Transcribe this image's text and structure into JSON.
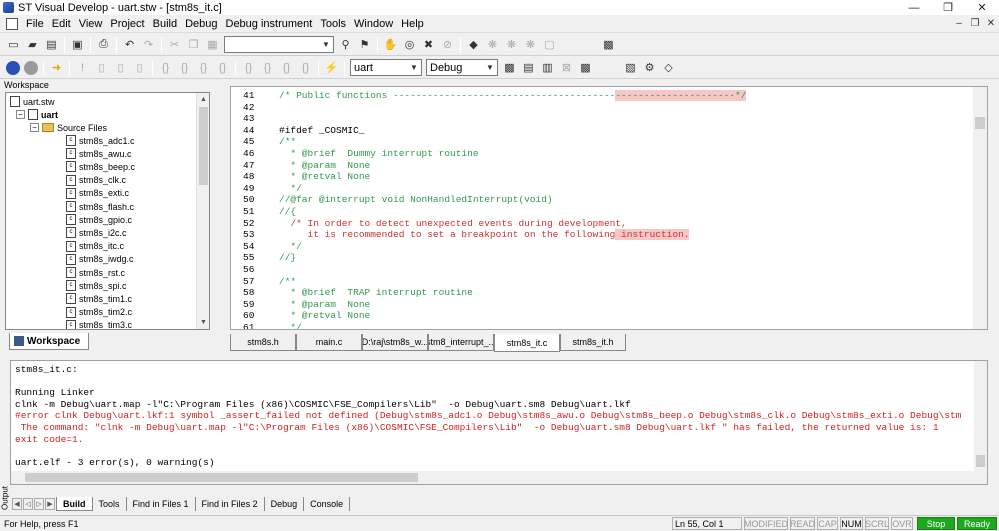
{
  "window": {
    "title": "ST Visual Develop - uart.stw - [stm8s_it.c]",
    "controls": [
      "—",
      "❐",
      "✕"
    ],
    "mdi_controls": [
      "–",
      "❐",
      "✕"
    ]
  },
  "menu": [
    "File",
    "Edit",
    "View",
    "Project",
    "Build",
    "Debug",
    "Debug instrument",
    "Tools",
    "Window",
    "Help"
  ],
  "toolbar": {
    "find_value": "",
    "project_combo": "uart",
    "config_combo": "Debug"
  },
  "workspace": {
    "header": "Workspace",
    "tab_label": "Workspace",
    "root": "uart.stw",
    "project": "uart",
    "folder": "Source Files",
    "files": [
      "stm8s_adc1.c",
      "stm8s_awu.c",
      "stm8s_beep.c",
      "stm8s_clk.c",
      "stm8s_exti.c",
      "stm8s_flash.c",
      "stm8s_gpio.c",
      "stm8s_i2c.c",
      "stm8s_itc.c",
      "stm8s_iwdg.c",
      "stm8s_rst.c",
      "stm8s_spi.c",
      "stm8s_tim1.c",
      "stm8s_tim2.c",
      "stm8s_tim3.c"
    ]
  },
  "editor": {
    "lines": [
      {
        "n": "41",
        "text": "/* Public functions ------------------------------------------------------------*/",
        "kind": "comment"
      },
      {
        "n": "42",
        "text": "",
        "kind": "plain"
      },
      {
        "n": "43",
        "text": "",
        "kind": "plain"
      },
      {
        "n": "44",
        "text": "#ifdef _COSMIC_",
        "kind": "plain"
      },
      {
        "n": "45",
        "text": "/**",
        "kind": "comment"
      },
      {
        "n": "46",
        "text": "  * @brief  Dummy interrupt routine",
        "kind": "comment"
      },
      {
        "n": "47",
        "text": "  * @param  None",
        "kind": "comment"
      },
      {
        "n": "48",
        "text": "  * @retval None",
        "kind": "comment"
      },
      {
        "n": "49",
        "text": "  */",
        "kind": "comment"
      },
      {
        "n": "50",
        "text": "//@far @interrupt void NonHandledInterrupt(void)",
        "kind": "comment"
      },
      {
        "n": "51",
        "text": "//{",
        "kind": "comment"
      },
      {
        "n": "52",
        "text": "  /* In order to detect unexpected events during development,",
        "kind": "comment"
      },
      {
        "n": "53",
        "text": "     it is recommended to set a breakpoint on the following instruction.",
        "kind": "comment"
      },
      {
        "n": "54",
        "text": "  */",
        "kind": "comment"
      },
      {
        "n": "55",
        "text": "//}",
        "kind": "comment"
      },
      {
        "n": "56",
        "text": "",
        "kind": "plain"
      },
      {
        "n": "57",
        "text": "/**",
        "kind": "comment"
      },
      {
        "n": "58",
        "text": "  * @brief  TRAP interrupt routine",
        "kind": "comment"
      },
      {
        "n": "59",
        "text": "  * @param  None",
        "kind": "comment"
      },
      {
        "n": "60",
        "text": "  * @retval None",
        "kind": "comment"
      },
      {
        "n": "61",
        "text": "  */",
        "kind": "comment"
      }
    ],
    "file_tabs": [
      "stm8s.h",
      "main.c",
      "D:\\raj\\stm8s_w...",
      "stm8_interrupt_...",
      "stm8s_it.c",
      "stm8s_it.h"
    ],
    "active_tab": 4
  },
  "output": {
    "side_label": "Output",
    "lines": [
      {
        "text": "stm8s_it.c:",
        "err": false
      },
      {
        "text": "",
        "err": false
      },
      {
        "text": "Running Linker",
        "err": false
      },
      {
        "text": "clnk -m Debug\\uart.map -l\"C:\\Program Files (x86)\\COSMIC\\FSE_Compilers\\Lib\"  -o Debug\\uart.sm8 Debug\\uart.lkf",
        "err": false
      },
      {
        "text": "#error clnk Debug\\uart.lkf:1 symbol _assert_failed not defined (Debug\\stm8s_adc1.o Debug\\stm8s_awu.o Debug\\stm8s_beep.o Debug\\stm8s_clk.o Debug\\stm8s_exti.o Debug\\stm",
        "err": true
      },
      {
        "text": " The command: \"clnk -m Debug\\uart.map -l\"C:\\Program Files (x86)\\COSMIC\\FSE_Compilers\\Lib\"  -o Debug\\uart.sm8 Debug\\uart.lkf \" has failed, the returned value is: 1",
        "err": true
      },
      {
        "text": "exit code=1.",
        "err": true
      },
      {
        "text": "",
        "err": false
      },
      {
        "text": "uart.elf - 3 error(s), 0 warning(s)",
        "err": false
      }
    ],
    "tabs": [
      "Build",
      "Tools",
      "Find in Files 1",
      "Find in Files 2",
      "Debug",
      "Console"
    ],
    "active_tab": 0
  },
  "status": {
    "help": "For Help, press F1",
    "position": "Ln 55, Col 1",
    "indicators": [
      {
        "label": "MODIFIED",
        "on": false
      },
      {
        "label": "READ",
        "on": false
      },
      {
        "label": "CAP",
        "on": false
      },
      {
        "label": "NUM",
        "on": true
      },
      {
        "label": "SCRL",
        "on": false
      },
      {
        "label": "OVR",
        "on": false
      }
    ],
    "stop": "Stop",
    "ready": "Ready"
  }
}
